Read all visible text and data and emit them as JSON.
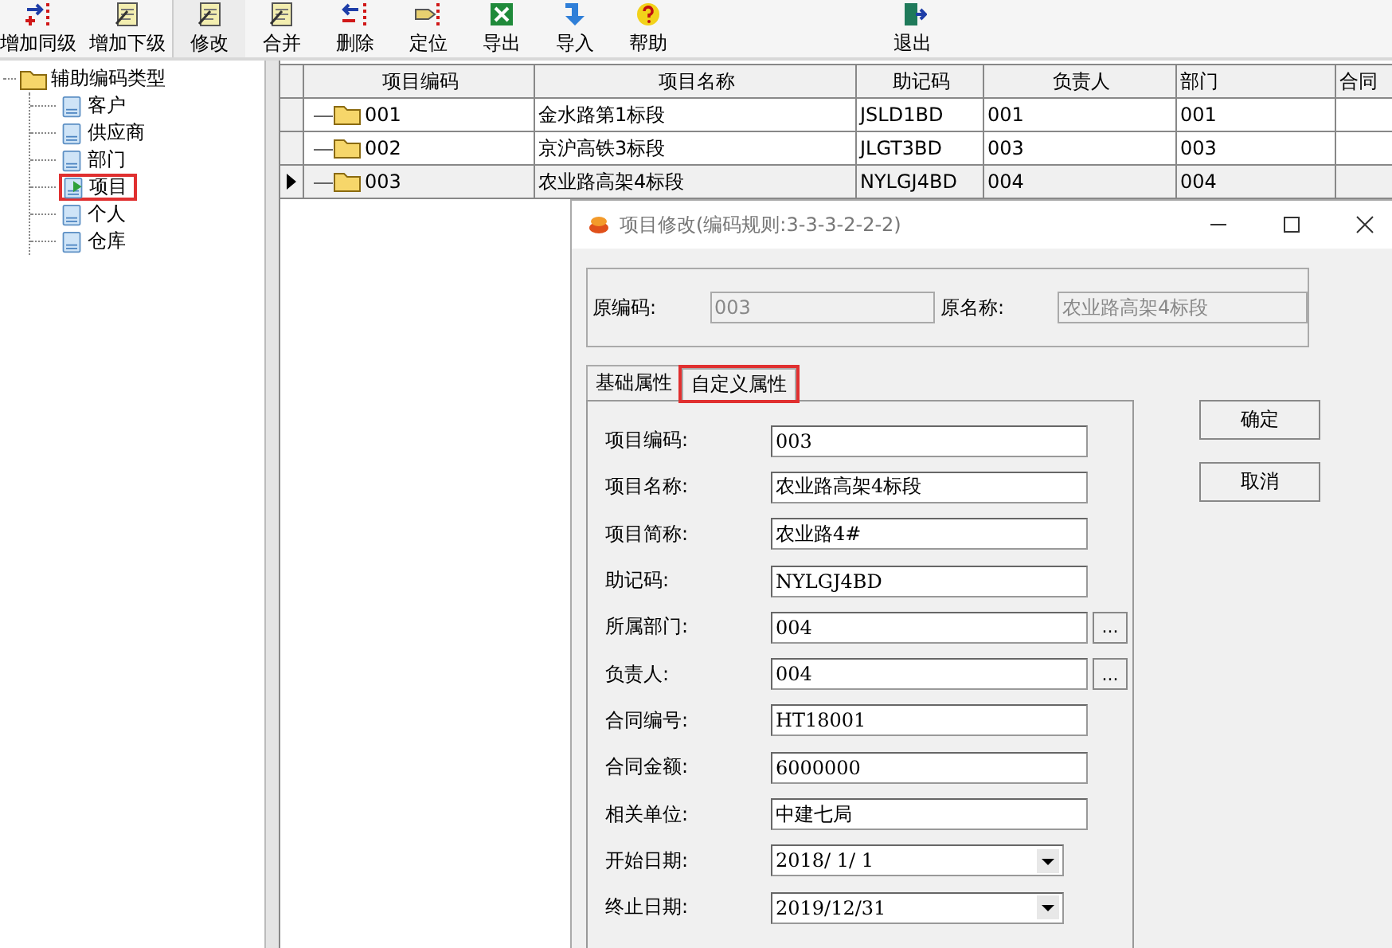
{
  "toolbar": [
    {
      "label": "增加同级"
    },
    {
      "label": "增加下级"
    },
    {
      "label": "修改"
    },
    {
      "label": "合并"
    },
    {
      "label": "删除"
    },
    {
      "label": "定位"
    },
    {
      "label": "导出"
    },
    {
      "label": "导入"
    },
    {
      "label": "帮助"
    },
    {
      "label": "退出"
    }
  ],
  "tree": {
    "label": "辅助编码类型",
    "children": [
      {
        "label": "客户",
        "selected": false
      },
      {
        "label": "供应商",
        "selected": false
      },
      {
        "label": "部门",
        "selected": false
      },
      {
        "label": "项目",
        "selected": true
      },
      {
        "label": "个人",
        "selected": false
      },
      {
        "label": "仓库",
        "selected": false
      }
    ]
  },
  "table": {
    "columns": [
      "项目编码",
      "项目名称",
      "助记码",
      "负责人",
      "部门",
      "合同"
    ],
    "rows": [
      {
        "selected": false,
        "cells": [
          "001",
          "金水路第1标段",
          "JSLD1BD",
          "001",
          "001",
          ""
        ]
      },
      {
        "selected": false,
        "cells": [
          "002",
          "京沪高铁3标段",
          "JLGT3BD",
          "003",
          "003",
          ""
        ]
      },
      {
        "selected": true,
        "cells": [
          "003",
          "农业路高架4标段",
          "NYLGJ4BD",
          "004",
          "004",
          ""
        ]
      }
    ]
  },
  "dialog": {
    "title": "项目修改(编码规则:3-3-3-2-2-2)",
    "original": [
      {
        "label": "原编码:",
        "value": "003",
        "disabled": true
      },
      {
        "label": "原名称:",
        "value": "农业路高架4标段",
        "disabled": true
      }
    ],
    "tabs": [
      {
        "label": "基础属性",
        "selected": true,
        "highlighted": false
      },
      {
        "label": "自定义属性",
        "selected": false,
        "highlighted": true
      }
    ],
    "fields": [
      {
        "kind": "text",
        "label": "项目编码:",
        "value": "003"
      },
      {
        "kind": "text",
        "label": "项目名称:",
        "value": "农业路高架4标段"
      },
      {
        "kind": "text",
        "label": "项目简称:",
        "value": "农业路4#"
      },
      {
        "kind": "text",
        "label": "助记码:",
        "value": "NYLGJ4BD"
      },
      {
        "kind": "lookup",
        "label": "所属部门:",
        "value": "004",
        "button": "..."
      },
      {
        "kind": "lookup",
        "label": "负责人:",
        "value": "004",
        "button": "..."
      },
      {
        "kind": "text",
        "label": "合同编号:",
        "value": "HT18001"
      },
      {
        "kind": "text",
        "label": "合同金额:",
        "value": "6000000"
      },
      {
        "kind": "text",
        "label": "相关单位:",
        "value": "中建七局"
      },
      {
        "kind": "date",
        "label": "开始日期:",
        "value": "2018/ 1/ 1"
      },
      {
        "kind": "date",
        "label": "终止日期:",
        "value": "2019/12/31"
      }
    ],
    "buttons": [
      "确定",
      "取消"
    ]
  }
}
